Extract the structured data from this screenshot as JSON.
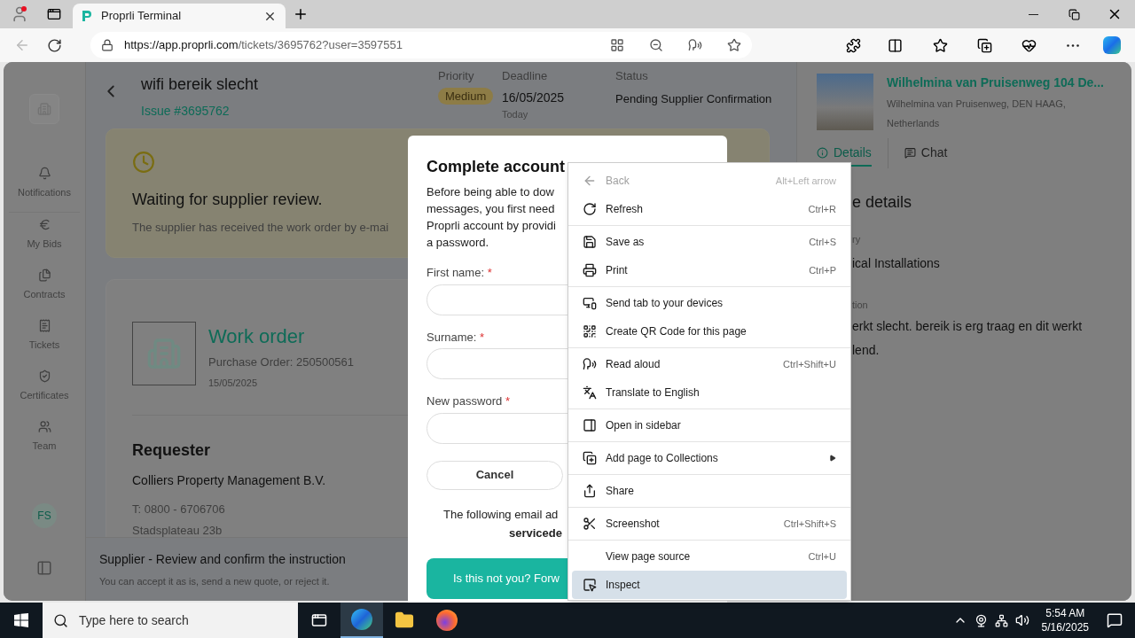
{
  "browser": {
    "tab_title": "Proprli Terminal",
    "url_host": "https://app.proprli.com",
    "url_path": "/tickets/3695762?user=3597551"
  },
  "sidebar": {
    "items": [
      {
        "label": "Notifications"
      },
      {
        "label": "My Bids"
      },
      {
        "label": "Contracts"
      },
      {
        "label": "Tickets"
      },
      {
        "label": "Certificates"
      },
      {
        "label": "Team"
      }
    ],
    "avatar": "FS"
  },
  "ticket": {
    "title": "wifi bereik slecht",
    "issue": "Issue #3695762",
    "priority_label": "Priority",
    "priority": "Medium",
    "deadline_label": "Deadline",
    "deadline": "16/05/2025",
    "deadline_note": "Today",
    "status_label": "Status",
    "status": "Pending Supplier Confirmation"
  },
  "waiting_card": {
    "title": "Waiting for supplier review.",
    "text": "The supplier has received the work order by e-mai"
  },
  "work_order": {
    "title": "Work order",
    "purchase_order": "Purchase Order: 250500561",
    "date": "15/05/2025"
  },
  "requester": {
    "heading": "Requester",
    "company": "Colliers Property Management B.V.",
    "phone": "T: 0800 - 6706706",
    "address": "Stadsplateau 23b"
  },
  "action_bar": {
    "title": "Supplier - Review and confirm the instruction",
    "text": "You can accept it as is, send a new quote, or reject it."
  },
  "property": {
    "name": "Wilhelmina van Pruisenweg 104 De...",
    "address_lines": [
      "Wilhelmina van Pruisenweg, DEN HAAG,",
      "Netherlands"
    ]
  },
  "panel_tabs": [
    {
      "label": "Details",
      "selected": true
    },
    {
      "label": "Chat",
      "selected": false
    }
  ],
  "details": {
    "heading": "e details",
    "category_label": "ry",
    "category": "ical Installations",
    "description_label": "tion",
    "description_lines": [
      "erkt slecht. bereik is erg traag en dit werkt",
      "lend."
    ]
  },
  "modal": {
    "title": "Complete account",
    "intro_lines": [
      "Before being able to dow",
      "messages, you first need",
      "Proprli account by providi",
      "a password."
    ],
    "fields": [
      {
        "label": "First name:",
        "marker": "*"
      },
      {
        "label": "Surname:",
        "marker": "*"
      },
      {
        "label": "New password",
        "marker": "*"
      }
    ],
    "cancel": "Cancel",
    "email_lines": [
      "The following email ad",
      "servicede"
    ],
    "forward": "Is this not you? Forw"
  },
  "context_menu": [
    [
      {
        "label": "Back",
        "shortcut": "Alt+Left arrow",
        "kind": "action",
        "disabled": true,
        "selected": false
      },
      {
        "label": "Refresh",
        "shortcut": "Ctrl+R",
        "kind": "action",
        "disabled": false,
        "selected": false
      }
    ],
    [
      {
        "label": "Save as",
        "shortcut": "Ctrl+S",
        "kind": "action",
        "disabled": false,
        "selected": false
      },
      {
        "label": "Print",
        "shortcut": "Ctrl+P",
        "kind": "action",
        "disabled": false,
        "selected": false
      }
    ],
    [
      {
        "label": "Send tab to your devices",
        "kind": "action",
        "disabled": false,
        "selected": false
      },
      {
        "label": "Create QR Code for this page",
        "kind": "action",
        "disabled": false,
        "selected": false
      }
    ],
    [
      {
        "label": "Read aloud",
        "shortcut": "Ctrl+Shift+U",
        "kind": "action",
        "disabled": false,
        "selected": false
      },
      {
        "label": "Translate to English",
        "kind": "action",
        "disabled": false,
        "selected": false
      }
    ],
    [
      {
        "label": "Open in sidebar",
        "kind": "action",
        "disabled": false,
        "selected": false
      }
    ],
    [
      {
        "label": "Add page to Collections",
        "kind": "submenu",
        "disabled": false,
        "selected": false
      }
    ],
    [
      {
        "label": "Share",
        "kind": "action",
        "disabled": false,
        "selected": false
      }
    ],
    [
      {
        "label": "Screenshot",
        "shortcut": "Ctrl+Shift+S",
        "kind": "action",
        "disabled": false,
        "selected": false
      }
    ],
    [
      {
        "label": "View page source",
        "shortcut": "Ctrl+U",
        "kind": "action",
        "disabled": false,
        "selected": false
      },
      {
        "label": "Inspect",
        "kind": "action",
        "disabled": false,
        "selected": true
      }
    ]
  ],
  "taskbar": {
    "search_placeholder": "Type here to search",
    "time": "5:54 AM",
    "date": "5/16/2025"
  }
}
